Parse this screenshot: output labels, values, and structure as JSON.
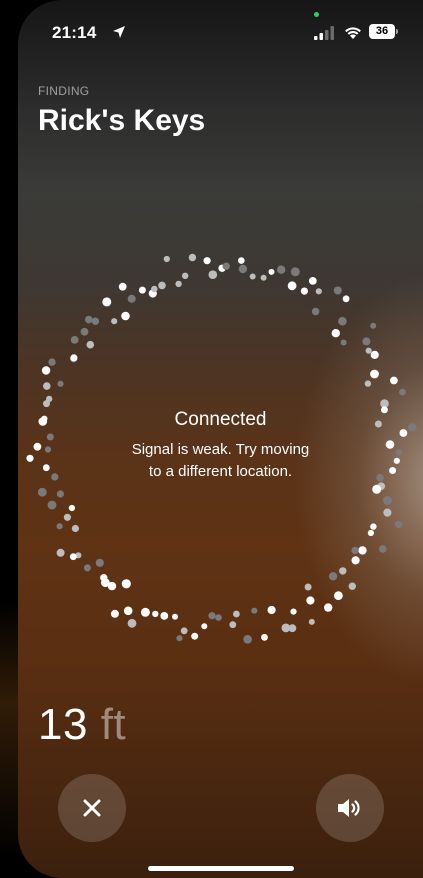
{
  "status_bar": {
    "time": "21:14",
    "battery": "36",
    "icons": [
      "location-arrow-icon",
      "cellular-signal-icon",
      "wifi-icon",
      "battery-icon"
    ]
  },
  "header": {
    "label": "FINDING",
    "title": "Rick's Keys"
  },
  "finder": {
    "status": "Connected",
    "message_line1": "Signal is weak. Try moving",
    "message_line2": "to a different location.",
    "distance_value": "13",
    "distance_unit": "ft"
  },
  "controls": {
    "close_icon": "close-icon",
    "sound_icon": "speaker-icon"
  },
  "colors": {
    "accent_green": "#30d158",
    "background_top": "#1e1e1e",
    "background_bottom": "#5a2f12"
  }
}
